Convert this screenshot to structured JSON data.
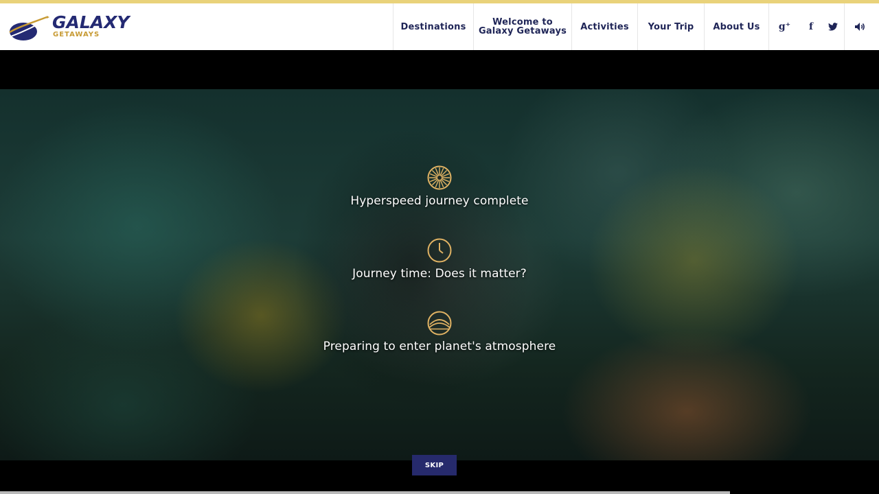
{
  "brand": {
    "name": "GALAXY",
    "tagline": "GETAWAYS",
    "colors": {
      "navy": "#242a73",
      "gold": "#c79a33",
      "accent_bar": "#e9d27a"
    }
  },
  "nav": {
    "items": [
      {
        "label": "Destinations"
      },
      {
        "label": "Welcome to\nGalaxy Getaways"
      },
      {
        "label": "Activities"
      },
      {
        "label": "Your Trip"
      },
      {
        "label": "About Us"
      }
    ],
    "social": [
      {
        "icon": "google-plus-icon",
        "glyph": "g⁺"
      },
      {
        "icon": "facebook-icon",
        "glyph": "f"
      },
      {
        "icon": "twitter-icon",
        "glyph": "🐦"
      },
      {
        "icon": "sound-icon",
        "glyph": "◀)"
      }
    ]
  },
  "intro": {
    "statuses": [
      {
        "icon": "hyperspeed-icon",
        "label": "Hyperspeed journey complete"
      },
      {
        "icon": "clock-icon",
        "label": "Journey time: Does it matter?"
      },
      {
        "icon": "atmosphere-icon",
        "label": "Preparing to enter planet's atmosphere"
      }
    ],
    "skip_label": "SKIP",
    "icon_color": "#e1b364",
    "skip_color": "#262a6c"
  }
}
